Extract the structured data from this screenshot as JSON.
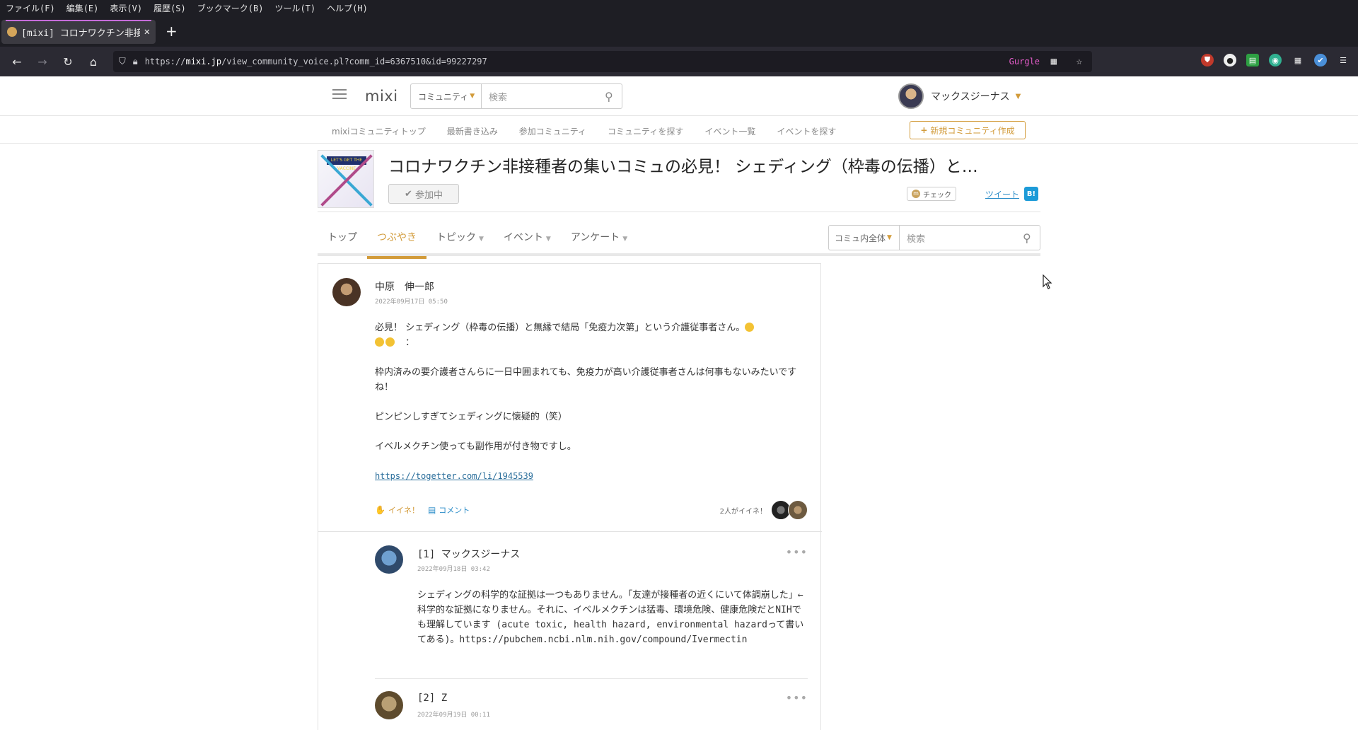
{
  "browser": {
    "menu": [
      "ファイル(F)",
      "編集(E)",
      "表示(V)",
      "履歴(S)",
      "ブックマーク(B)",
      "ツール(T)",
      "ヘルプ(H)"
    ],
    "tab_title": "[mixi] コロナワクチン非接",
    "url_host_prefix": "https://",
    "url_host": "mixi.jp",
    "url_path": "/view_community_voice.pl?comm_id=6367510&id=99227297",
    "ext_gurgle": "Gurgle"
  },
  "site": {
    "logo": "mixi",
    "search_scope": "コミュニティ",
    "search_placeholder": "検索",
    "user_name": "マックスジーナス",
    "subnav": [
      "mixiコミュニティトップ",
      "最新書き込み",
      "参加コミュニティ",
      "コミュニティを探す",
      "イベント一覧",
      "イベントを探す"
    ],
    "new_community": "新規コミュニティ作成"
  },
  "community": {
    "thumb_text": "LET'S GET THE VACCINE",
    "title": "コロナワクチン非接種者の集いコミュの必見！ シェディング（枠毒の伝播）と…",
    "joined": "参加中",
    "check": "チェック",
    "tweet": "ツイート",
    "hatena": "B!",
    "tabs": [
      {
        "label": "トップ",
        "caret": false
      },
      {
        "label": "つぶやき",
        "caret": false,
        "active": true
      },
      {
        "label": "トピック",
        "caret": true
      },
      {
        "label": "イベント",
        "caret": true
      },
      {
        "label": "アンケート",
        "caret": true
      }
    ],
    "search_scope": "コミュ内全体",
    "search_placeholder": "検索"
  },
  "post": {
    "author": "中原　伸一郎",
    "date": "2022年09月17日 05:50",
    "line1": "必見！ シェディング（枠毒の伝播）と無縁で結局「免疫力次第」という介護従事者さん。",
    "line1b": "：",
    "para2": "枠内済みの要介護者さんらに一日中囲まれても、免疫力が高い介護従事者さんは何事もないみたいですね！",
    "para3": "ピンピンしすぎてシェディングに懐疑的（笑）",
    "para4": "イベルメクチン使っても副作用が付き物ですし。",
    "link": "https://togetter.com/li/1945539",
    "like_label": "イイネ！",
    "comment_label": "コメント",
    "likers_text": "2人がイイネ！"
  },
  "replies": [
    {
      "name": "[1] マックスジーナス",
      "date": "2022年09月18日 03:42",
      "body": "シェディングの科学的な証拠は一つもありません。「友達が接種者の近くにいて体調崩した」←科学的な証拠になりません。それに、イベルメクチンは猛毒、環境危険、健康危険だとNIHでも理解しています (acute toxic, health hazard, environmental hazardって書いてある)。https://pubchem.ncbi.nlm.nih.gov/compound/Ivermectin"
    },
    {
      "name": "[2] Z",
      "date": "2022年09月19日 00:11",
      "body": ""
    }
  ],
  "colors": {
    "accent": "#d29b3a",
    "link": "#2a8cc8",
    "chrome_dark": "#1e1e24"
  }
}
